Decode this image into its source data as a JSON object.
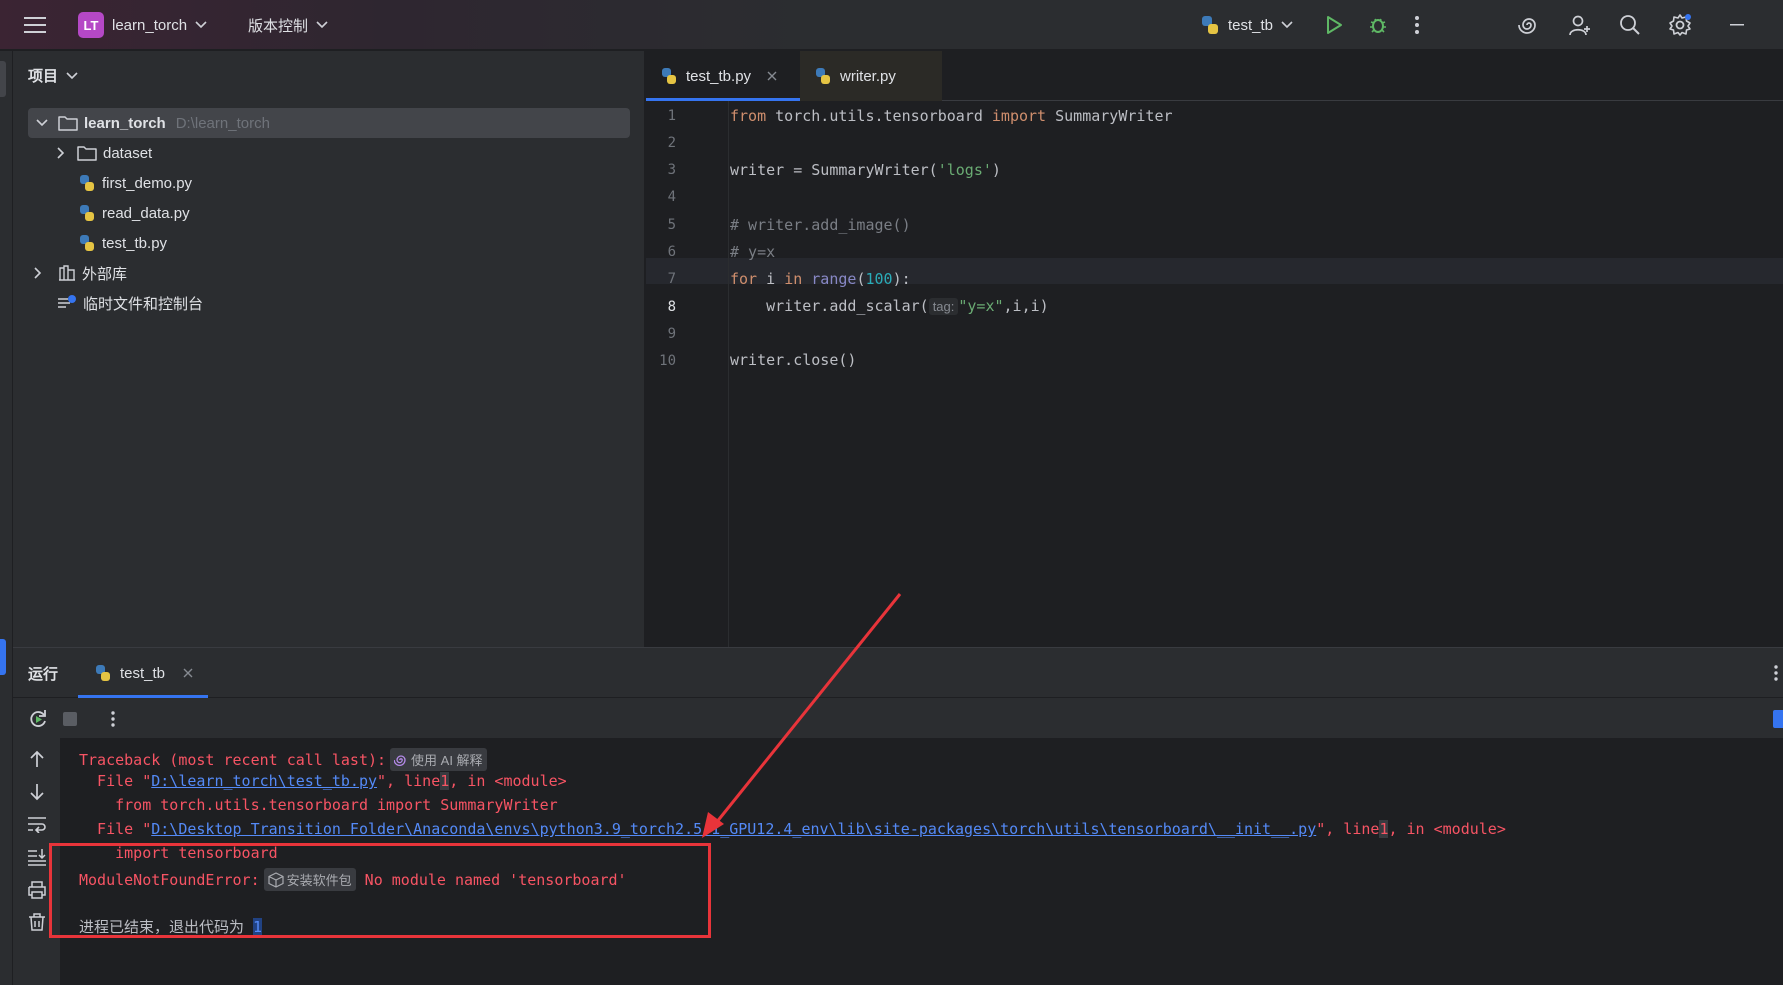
{
  "titlebar": {
    "project_badge": "LT",
    "project_name": "learn_torch",
    "vcs_label": "版本控制",
    "run_config": "test_tb"
  },
  "project_panel": {
    "title": "项目",
    "root": {
      "name": "learn_torch",
      "path": "D:\\learn_torch"
    },
    "items": [
      {
        "name": "dataset",
        "type": "folder"
      },
      {
        "name": "first_demo.py",
        "type": "python"
      },
      {
        "name": "read_data.py",
        "type": "python"
      },
      {
        "name": "test_tb.py",
        "type": "python"
      }
    ],
    "external_libs": "外部库",
    "scratches": "临时文件和控制台"
  },
  "editor": {
    "tabs": [
      {
        "label": "test_tb.py",
        "active": true,
        "closable": true
      },
      {
        "label": "writer.py",
        "active": false,
        "closable": false
      }
    ],
    "line_numbers": [
      "1",
      "2",
      "3",
      "4",
      "5",
      "6",
      "7",
      "8",
      "9",
      "10"
    ],
    "current_line": 8,
    "code": {
      "l1_from": "from",
      "l1_module": " torch.utils.tensorboard ",
      "l1_import": "import",
      "l1_name": " SummaryWriter",
      "l3_pre": "writer = SummaryWriter(",
      "l3_str": "'logs'",
      "l3_post": ")",
      "l5": "# writer.add_image()",
      "l6": "# y=x",
      "l7_for": "for",
      "l7_i": " i ",
      "l7_in": "in",
      "l7_range": "range",
      "l7_open": "(",
      "l7_num": "100",
      "l7_close": "):",
      "l8_pre": "    writer.add_scalar(",
      "l8_hint": "tag:",
      "l8_str": "\"y=x\"",
      "l8_post": ",i,i)",
      "l10": "writer.close()"
    }
  },
  "run_panel": {
    "title": "运行",
    "tab_label": "test_tb",
    "output": {
      "traceback": "Traceback (most recent call last):",
      "ai_explain": "使用 AI 解释",
      "file1_pre": "  File \"",
      "file1_path": "D:\\learn_torch\\test_tb.py",
      "file1_mid": "\", line",
      "file1_line": "1",
      "file1_post": ", in <module>",
      "src1": "    from torch.utils.tensorboard import SummaryWriter",
      "file2_pre": "  File \"",
      "file2_path": "D:\\Desktop Transition Folder\\Anaconda\\envs\\python3.9_torch2.5.1_GPU12.4_env\\lib\\site-packages\\torch\\utils\\tensorboard\\__init__.py",
      "file2_mid": "\", line",
      "file2_line": "1",
      "file2_post": ", in <module>",
      "src2": "    import tensorboard",
      "error_type": "ModuleNotFoundError:",
      "install_pkg": "安装软件包",
      "error_msg": " No module named 'tensorboard'",
      "exit_text": "进程已结束，退出代码为 ",
      "exit_code": "1"
    }
  },
  "colors": {
    "accent": "#3574f0",
    "error": "#f75464",
    "annotation": "#e8343a"
  }
}
